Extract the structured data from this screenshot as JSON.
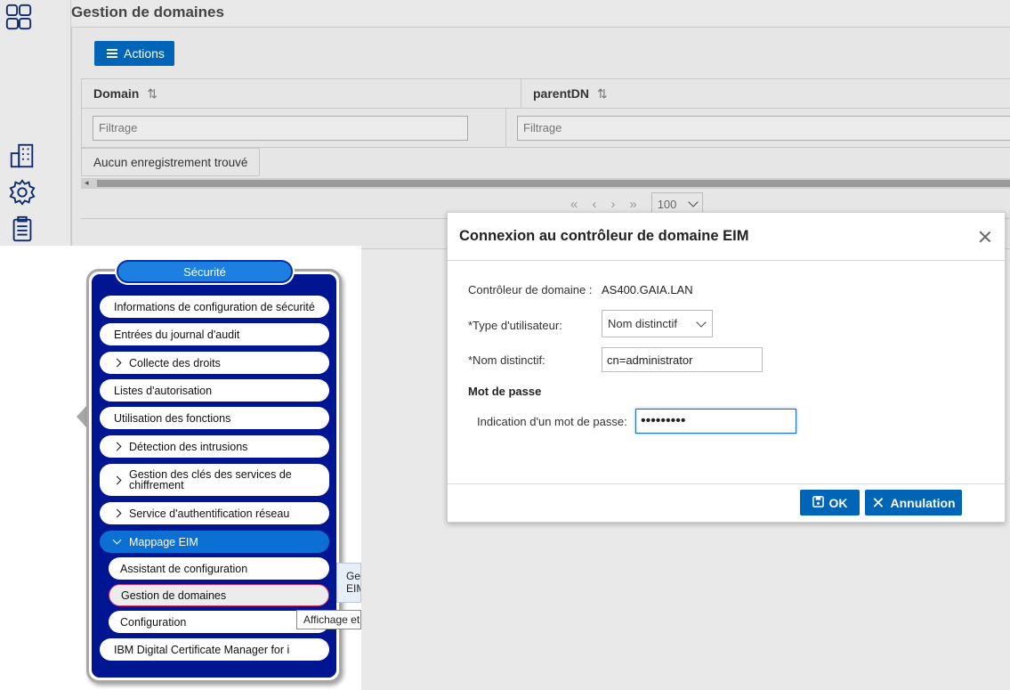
{
  "page": {
    "title": "Gestion de domaines"
  },
  "toolbar": {
    "actions_label": "Actions"
  },
  "grid": {
    "columns": [
      {
        "label": "Domain"
      },
      {
        "label": "parentDN"
      }
    ],
    "filter_placeholder": "Filtrage",
    "empty_text": "Aucun enregistrement trouvé",
    "pager": {
      "page_size": "100"
    }
  },
  "dialog": {
    "title": "Connexion au contrôleur de domaine EIM",
    "domain_controller_label": "Contrôleur de domaine :",
    "domain_controller_value": "AS400.GAIA.LAN",
    "user_type_label": "*Type d'utilisateur:",
    "user_type_value": "Nom distinctif",
    "dn_label": "*Nom distinctif:",
    "dn_value": "cn=administrator",
    "password_section": "Mot de passe",
    "password_hint_label": "Indication d'un mot de passe:",
    "password_value": "•••••••••",
    "ok_label": "OK",
    "cancel_label": "Annulation"
  },
  "menu": {
    "title": "Sécurité",
    "items": [
      {
        "label": "Informations de configuration de sécurité"
      },
      {
        "label": "Entrées du journal d'audit"
      },
      {
        "label": "Collecte des droits"
      },
      {
        "label": "Listes d'autorisation"
      },
      {
        "label": "Utilisation des fonctions"
      },
      {
        "label": "Détection des intrusions"
      },
      {
        "label": "Gestion des clés des services de chiffrement"
      },
      {
        "label": "Service d'authentification réseau"
      },
      {
        "label": "Mappage EIM"
      },
      {
        "label": "IBM Digital Certificate Manager for i"
      }
    ],
    "subitems": [
      {
        "label": "Assistant de configuration"
      },
      {
        "label": "Gestion de domaines"
      },
      {
        "label": "Configuration"
      }
    ],
    "tooltip_text": "Ge EIM",
    "tooltip2_text": "Affichage et"
  }
}
